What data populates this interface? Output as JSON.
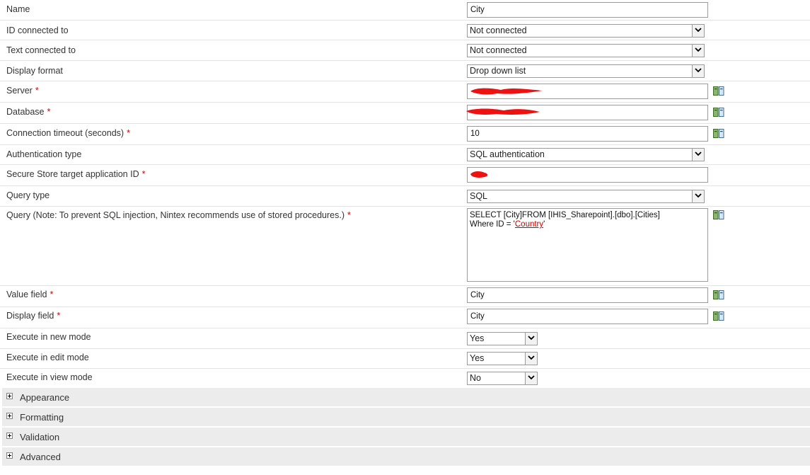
{
  "fields": {
    "name": {
      "label": "Name",
      "value": "City"
    },
    "id_connected": {
      "label": "ID connected to",
      "value": "Not connected"
    },
    "text_connected": {
      "label": "Text connected to",
      "value": "Not connected"
    },
    "display_format": {
      "label": "Display format",
      "value": "Drop down list"
    },
    "server": {
      "label": "Server",
      "required": "*"
    },
    "database": {
      "label": "Database",
      "required": "*"
    },
    "timeout": {
      "label": "Connection timeout (seconds)",
      "required": "*",
      "value": "10"
    },
    "auth_type": {
      "label": "Authentication type",
      "value": "SQL authentication"
    },
    "secure_store": {
      "label": "Secure Store target application ID",
      "required": "*"
    },
    "query_type": {
      "label": "Query type",
      "value": "SQL"
    },
    "query": {
      "label": "Query (Note: To prevent SQL injection, Nintex recommends use of stored procedures.)",
      "required": "*",
      "line1": "SELECT [City]FROM [IHIS_Sharepoint].[dbo].[Cities]",
      "line2_prefix": "Where ID = '",
      "line2_link": "Country",
      "line2_suffix": "'"
    },
    "value_field": {
      "label": "Value field",
      "required": "*",
      "value": "City"
    },
    "display_field": {
      "label": "Display field",
      "required": "*",
      "value": "City"
    },
    "exec_new": {
      "label": "Execute in new mode",
      "value": "Yes"
    },
    "exec_edit": {
      "label": "Execute in edit mode",
      "value": "Yes"
    },
    "exec_view": {
      "label": "Execute in view mode",
      "value": "No"
    }
  },
  "sections": {
    "appearance": "Appearance",
    "formatting": "Formatting",
    "validation": "Validation",
    "advanced": "Advanced"
  },
  "icons": {
    "picker": "insert-reference-icon",
    "dropdown": "chevron-down-icon",
    "expander": "plus-expand-icon"
  },
  "colors": {
    "required": "#cc0000",
    "redaction": "#ee1111",
    "section_bg": "#ececec"
  }
}
